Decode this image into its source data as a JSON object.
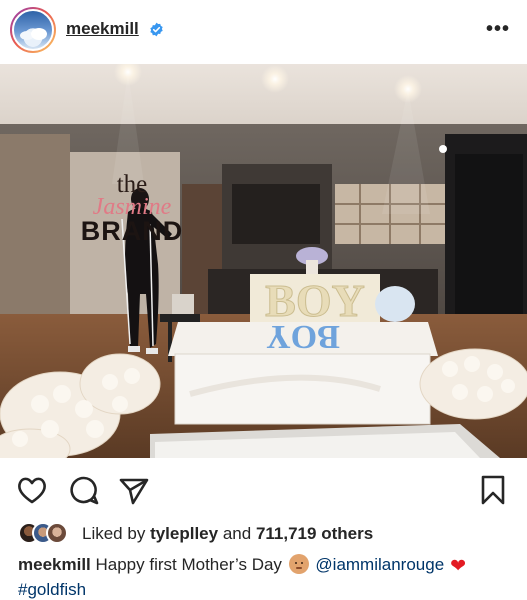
{
  "post": {
    "username": "meekmill",
    "verified": true,
    "more_label": "•••"
  },
  "photo": {
    "watermark_the": "the",
    "watermark_jasmine": "Jasmine",
    "watermark_brand": "BRAND",
    "cake_text": "BOY",
    "sign_text": "BOY"
  },
  "actions": {
    "like_icon": "heart-outline-icon",
    "comment_icon": "comment-icon",
    "share_icon": "paper-plane-icon",
    "save_icon": "bookmark-icon"
  },
  "likes": {
    "prefix": "Liked by",
    "user": "tyleplley",
    "joiner": "and",
    "count": "711,719 others"
  },
  "caption": {
    "author": "meekmill",
    "text": "Happy first Mother’s Day",
    "mention": "@iammilanrouge",
    "hashtag": "#goldfish"
  },
  "colors": {
    "text": "#262626",
    "link": "#003569",
    "verified": "#3897f0",
    "heart": "#e31b23"
  }
}
